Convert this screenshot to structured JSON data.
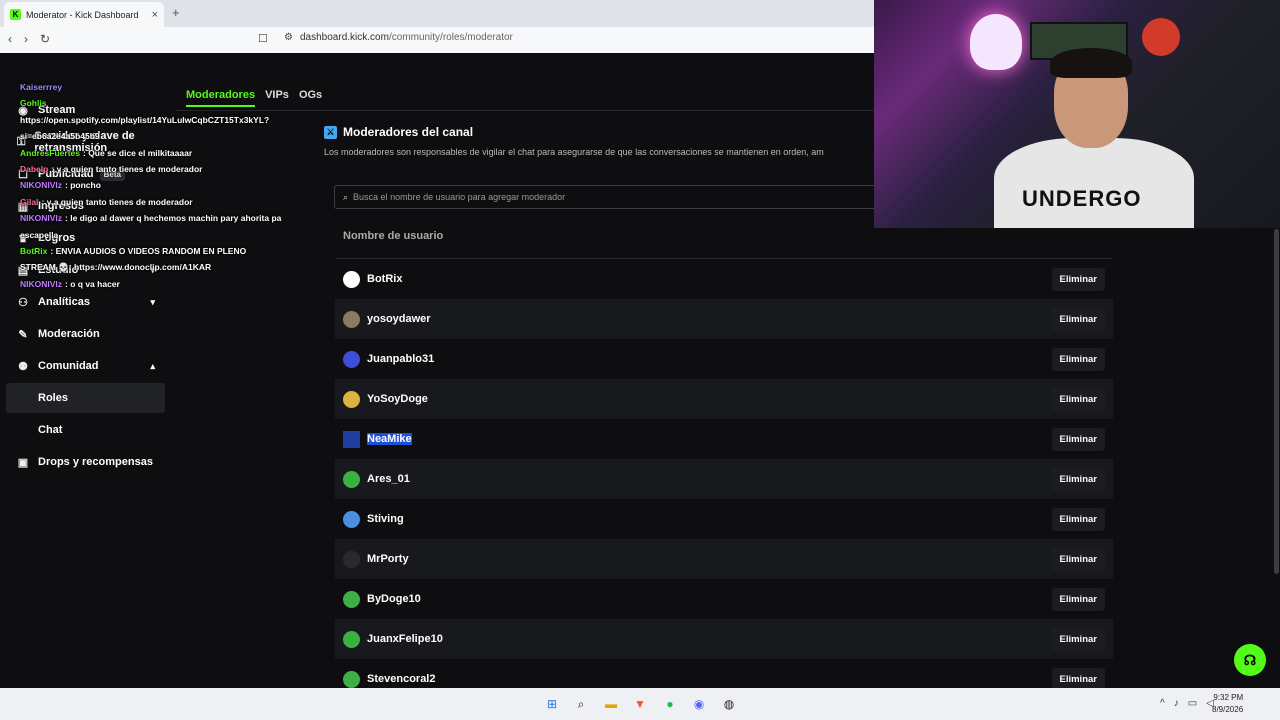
{
  "browser": {
    "tab_title": "Moderator - Kick Dashboard",
    "tab_close": "×",
    "new_tab": "+",
    "url_domain": "dashboard.kick.com",
    "url_path": "/community/roles/moderator"
  },
  "top_tabs": [
    {
      "label": "Moderadores"
    },
    {
      "label": "VIPs"
    },
    {
      "label": "OGs"
    }
  ],
  "sidebar": {
    "items": [
      {
        "label": "Stream",
        "icon": "broadcast-icon"
      },
      {
        "label": "Servidor y clave de retransmisión",
        "icon": "key-icon"
      },
      {
        "label": "Publicidad",
        "icon": "megaphone-icon",
        "badge": "Beta"
      },
      {
        "label": "Ingresos",
        "icon": "money-icon"
      },
      {
        "label": "Logros",
        "icon": "trophy-icon"
      },
      {
        "label": "Estudio",
        "icon": "palette-icon",
        "chevron": "▾"
      },
      {
        "label": "Analíticas",
        "icon": "chart-icon",
        "chevron": "▾"
      },
      {
        "label": "Moderación",
        "icon": "wrench-icon"
      },
      {
        "label": "Comunidad",
        "icon": "people-icon",
        "chevron": "▴"
      },
      {
        "label": "Roles"
      },
      {
        "label": "Chat"
      },
      {
        "label": "Drops y recompensas",
        "icon": "gift-icon"
      }
    ]
  },
  "chat_overlay": [
    {
      "user": "Kaiserrrey",
      "msg": "",
      "color": "#9b8cff"
    },
    {
      "user": "Gohlis",
      "msg": "",
      "color": "#53fc18"
    },
    {
      "user": "",
      "msg": "https://open.spotify.com/playlist/14YuLuIwCqbCZT15Tx3kYL?",
      "color": "#ffffff"
    },
    {
      "user": "",
      "msg": "si=eb6a2e4a5b45b9",
      "color": "#ffffff"
    },
    {
      "user": "AndresFuertes",
      "msg": ": Que se dice el milkitaaaar",
      "color": "#53fc18"
    },
    {
      "user": "Dabelp",
      "msg": ": y a quien tanto tienes de moderador",
      "color": "#ff6b9a"
    },
    {
      "user": "NIKONIVIz",
      "msg": ": poncho",
      "color": "#c27aff"
    },
    {
      "user": "Gilal",
      "msg": ": y a quien tanto tienes de moderador",
      "color": "#ff6b9a"
    },
    {
      "user": "NIKONIVIz",
      "msg": ": le digo al dawer q hechemos machin pary ahorita pa",
      "color": "#c27aff"
    },
    {
      "user": "",
      "msg": "escapella",
      "color": "#ffffff"
    },
    {
      "user": "BotRix",
      "msg": ": ENVIA AUDIOS O VIDEOS RANDOM EN PLENO",
      "color": "#53fc18"
    },
    {
      "user": "",
      "msg": "STREAM 💀: https://www.donoclip.com/A1KAR",
      "color": "#ffffff"
    },
    {
      "user": "NIKONIVIz",
      "msg": ": o q va hacer",
      "color": "#c27aff"
    }
  ],
  "section": {
    "title": "Moderadores del canal",
    "description": "Los moderadores son responsables de vigilar el chat para asegurarse de que las conversaciones se mantienen en orden, am",
    "search_placeholder": "Busca el nombre de usuario para agregar moderador"
  },
  "table": {
    "header": "Nombre de usuario",
    "remove_label": "Eliminar",
    "rows": [
      {
        "name": "BotRix",
        "avatar_color": "#ffffff"
      },
      {
        "name": "yosoydawer",
        "avatar_color": "#8a7a60"
      },
      {
        "name": "Juanpablo31",
        "avatar_color": "#3b4fd8"
      },
      {
        "name": "YoSoyDoge",
        "avatar_color": "#e0b040"
      },
      {
        "name": "NeaMike",
        "avatar_color": "#1f3fa0",
        "selected": true
      },
      {
        "name": "Ares_01",
        "avatar_color": "#3cb043"
      },
      {
        "name": "Stiving",
        "avatar_color": "#4a90e2"
      },
      {
        "name": "MrPorty",
        "avatar_color": "#2a2a2a"
      },
      {
        "name": "ByDoge10",
        "avatar_color": "#3cb043"
      },
      {
        "name": "JuanxFelipe10",
        "avatar_color": "#3cb043"
      },
      {
        "name": "Stevencoral2",
        "avatar_color": "#3cb043"
      }
    ]
  },
  "webcam": {
    "shirt_text": "UNDERGO"
  },
  "clock": {
    "time": "9:32 PM",
    "date": "8/9/2026"
  }
}
